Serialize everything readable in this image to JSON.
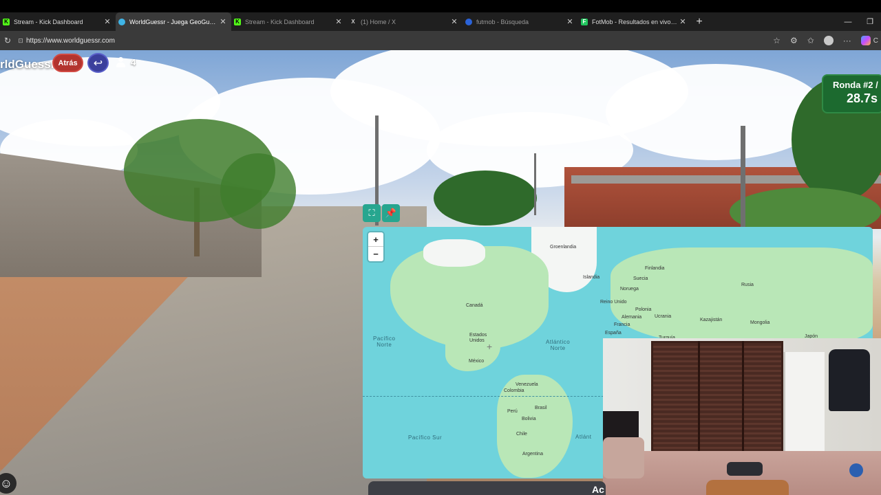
{
  "browser": {
    "tabs": [
      {
        "label": "Stream - Kick Dashboard",
        "favicon_color": "#53fc18",
        "favicon": "K",
        "active": false
      },
      {
        "label": "WorldGuessr - Juega GeoGuessr g",
        "favicon_color": "#3fb4e6",
        "favicon": "",
        "active": true
      },
      {
        "label": "Stream - Kick Dashboard",
        "favicon_color": "#53fc18",
        "favicon": "K",
        "active": false
      },
      {
        "label": "(1) Home / X",
        "favicon_color": "#cccccc",
        "favicon": "X",
        "active": false
      },
      {
        "label": "futmob - Búsqueda",
        "favicon_color": "#2b63d9",
        "favicon": "",
        "active": false
      },
      {
        "label": "FotMob - Resultados en vivo de fú",
        "favicon_color": "#22c55e",
        "favicon": "F",
        "active": false
      }
    ],
    "new_tab": "+",
    "url": "https://www.worldguessr.com",
    "copilot_label": "C"
  },
  "game": {
    "brand": "rldGuessr",
    "back_button_label": "Atrás",
    "player_count": "4",
    "round_label": "Ronda #2 /",
    "timer": "28.7s",
    "bottom_text": "Ac"
  },
  "map": {
    "zoom_in": "+",
    "zoom_out": "−",
    "countries": [
      "Groenlandia",
      "Islandia",
      "Suecia",
      "Finlandia",
      "Noruega",
      "Rusia",
      "Reino Unido",
      "Polonia",
      "Alemania",
      "Ucrania",
      "Kazajistán",
      "Mongolia",
      "Francia",
      "España",
      "Turquía",
      "Japón",
      "Canadá",
      "Estados Unidos",
      "México",
      "Venezuela",
      "Colombia",
      "Brasil",
      "Perú",
      "Bolivia",
      "Chile",
      "Argentina"
    ],
    "oceans": {
      "north_pacific": "Pacífico\nNorte",
      "north_atlantic": "Atlántico\nNorte",
      "south_pacific": "Pacífico Sur",
      "south_atlantic": "Atlánt"
    }
  },
  "colors": {
    "atras_red": "#b3342f",
    "back_blue": "#3b3f9c",
    "timer_green": "#1c6a2f",
    "map_water": "#6fd3dc",
    "map_land": "#b9e7b7",
    "tool_teal": "#27a68f"
  }
}
